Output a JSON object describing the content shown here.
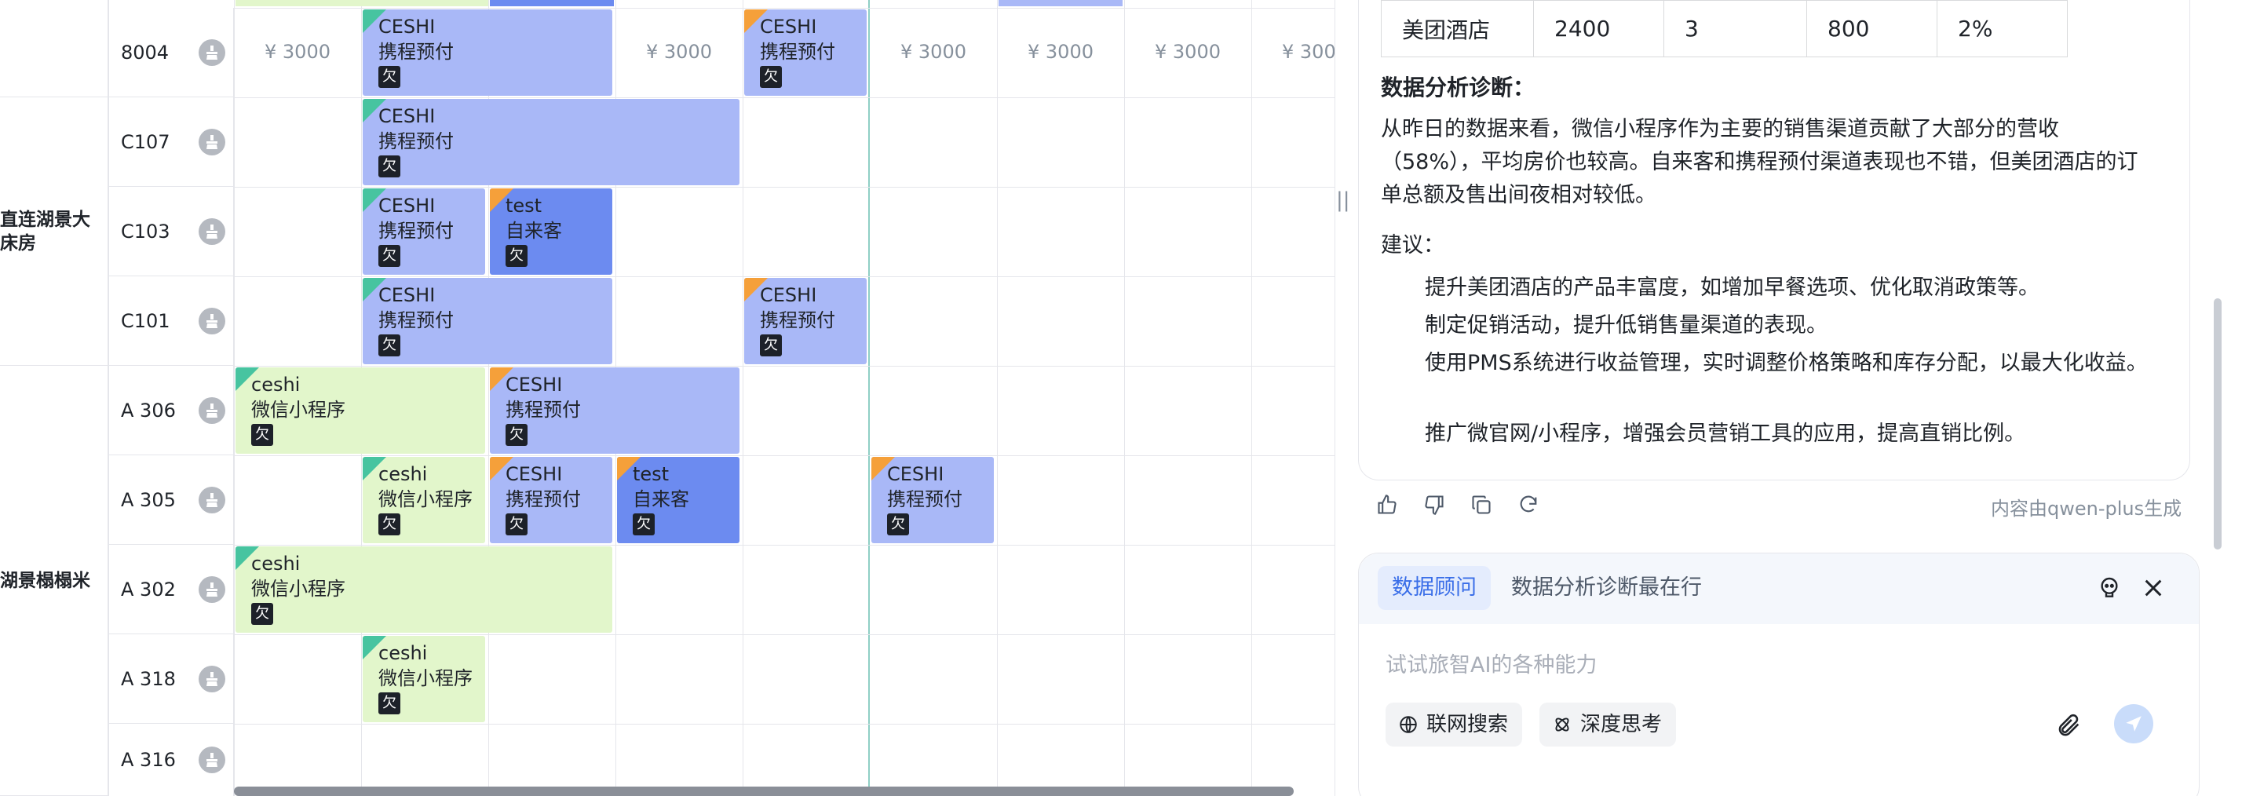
{
  "grid": {
    "price": "¥ 3000",
    "owe_badge": "欠",
    "room_types": [
      {
        "label": "直连湖景大\n床房"
      },
      {
        "label": "湖景榻榻米"
      }
    ],
    "rooms": [
      "8004",
      "C107",
      "C103",
      "C101",
      "A 306",
      "A 305",
      "A 302",
      "A 318",
      "A 316"
    ],
    "bookings": [
      {
        "name": "CESHI",
        "channel": "携程预付"
      },
      {
        "name": "CESHI",
        "channel": "携程预付"
      },
      {
        "name": "CESHI",
        "channel": "携程预付"
      },
      {
        "name": "CESHI",
        "channel": "携程预付"
      },
      {
        "name": "test",
        "channel": "自来客"
      },
      {
        "name": "CESHI",
        "channel": "携程预付"
      },
      {
        "name": "CESHI",
        "channel": "携程预付"
      },
      {
        "name": "ceshi",
        "channel": "微信小程序"
      },
      {
        "name": "CESHI",
        "channel": "携程预付"
      },
      {
        "name": "ceshi",
        "channel": "微信小程序"
      },
      {
        "name": "CESHI",
        "channel": "携程预付"
      },
      {
        "name": "test",
        "channel": "自来客"
      },
      {
        "name": "CESHI",
        "channel": "携程预付"
      },
      {
        "name": "ceshi",
        "channel": "微信小程序"
      },
      {
        "name": "ceshi",
        "channel": "微信小程序"
      }
    ]
  },
  "panel": {
    "table_row": [
      "美团酒店",
      "2400",
      "3",
      "800",
      "2%"
    ],
    "diag_heading": "数据分析诊断：",
    "diag_text": "从昨日的数据来看，微信小程序作为主要的销售渠道贡献了大部分的营收（58%），平均房价也较高。自来客和携程预付渠道表现也不错，但美团酒店的订单总额及售出间夜相对较低。",
    "suggest_heading": "建议：",
    "suggestions": [
      "提升美团酒店的产品丰富度，如增加早餐选项、优化取消政策等。",
      "制定促销活动，提升低销售量渠道的表现。",
      "使用PMS系统进行收益管理，实时调整价格策略和库存分配，以最大化收益。",
      "推广微官网/小程序，增强会员营销工具的应用，提高直销比例。"
    ],
    "credit": "内容由qwen-plus生成",
    "chat": {
      "tag_advisor": "数据顾问",
      "tag_current": "数据分析诊断最在行",
      "placeholder": "试试旅智AI的各种能力",
      "web_search": "联网搜索",
      "deep_think": "深度思考"
    }
  }
}
